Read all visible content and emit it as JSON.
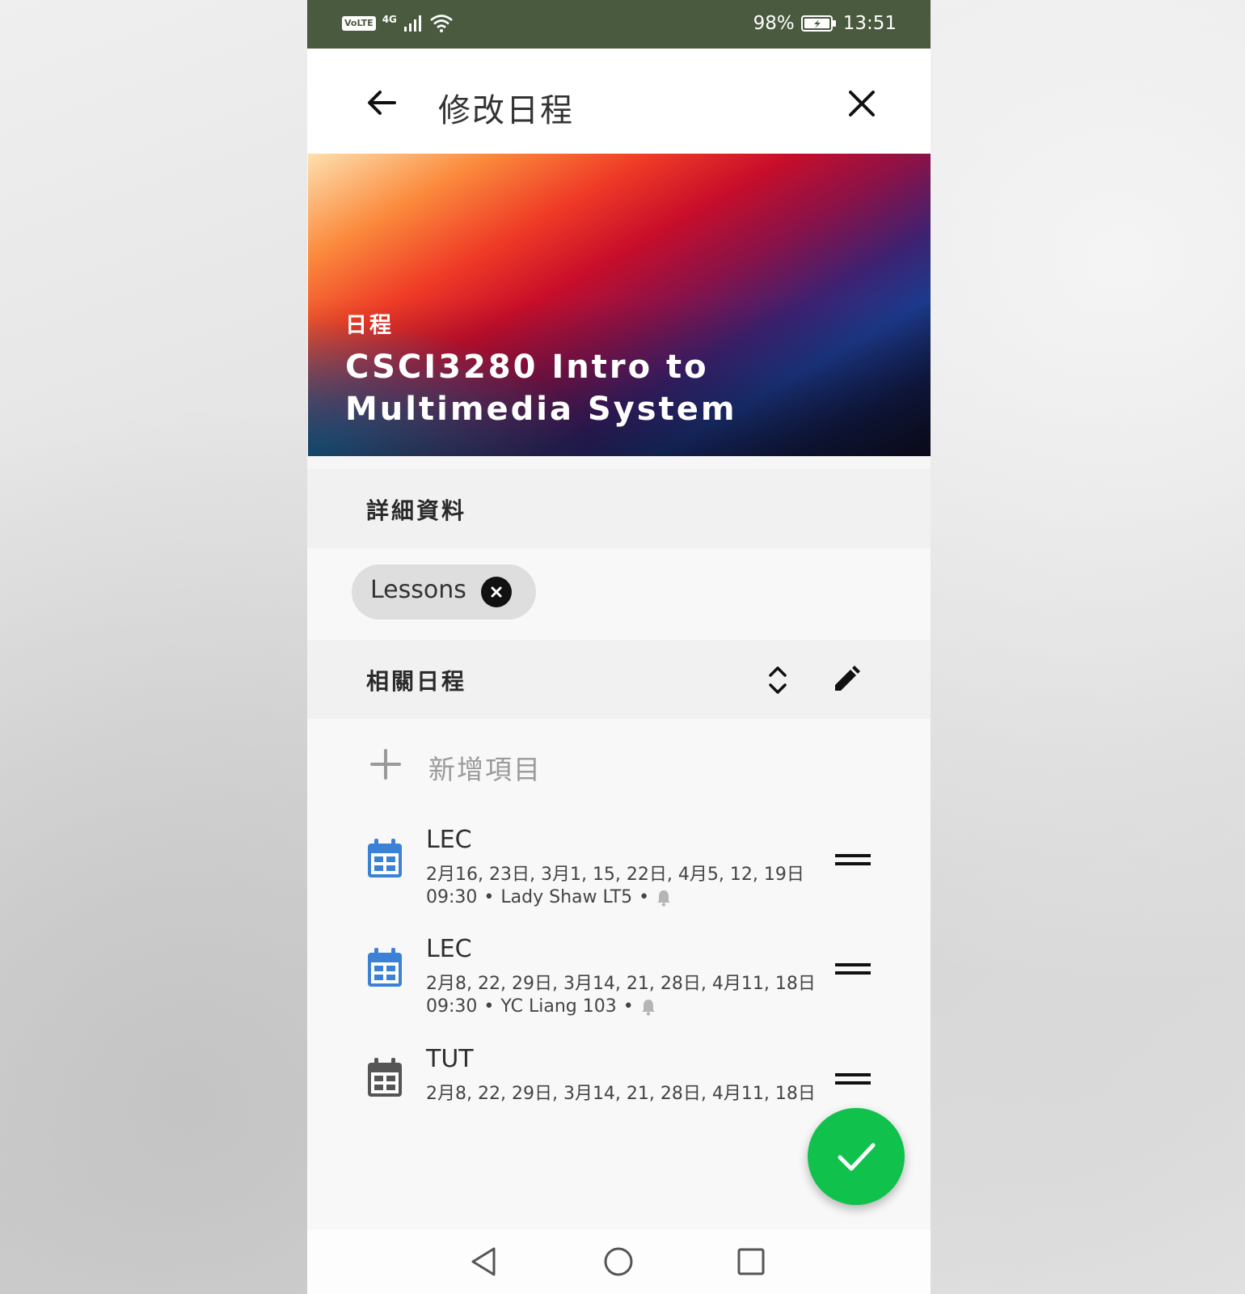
{
  "status_bar": {
    "volte": "VoLTE",
    "network": "4G",
    "battery": "98%",
    "time": "13:51"
  },
  "app_bar": {
    "title": "修改日程",
    "back_icon": "arrow-left-icon",
    "close_icon": "close-icon"
  },
  "banner": {
    "label": "日程",
    "title": "CSCI3280 Intro to Multimedia System"
  },
  "details": {
    "header": "詳細資料",
    "tags": [
      {
        "label": "Lessons"
      }
    ]
  },
  "related": {
    "header": "相關日程",
    "add_label": "新增項目",
    "items": [
      {
        "title": "LEC",
        "dates": "2月16, 23日, 3月1, 15, 22日, 4月5, 12, 19日",
        "time": "09:30",
        "location": "Lady Shaw LT5",
        "icon_color": "#3b82d6",
        "has_reminder": true
      },
      {
        "title": "LEC",
        "dates": "2月8, 22, 29日, 3月14, 21, 28日, 4月11, 18日",
        "time": "09:30",
        "location": "YC Liang 103",
        "icon_color": "#3b82d6",
        "has_reminder": true
      },
      {
        "title": "TUT",
        "dates": "2月8, 22, 29日, 3月14, 21, 28日, 4月11, 18日",
        "icon_color": "#555555"
      }
    ]
  },
  "fab": {
    "icon": "check-icon",
    "color": "#10c24c"
  },
  "nav_bar": {
    "icons": [
      "back-triangle-icon",
      "home-circle-icon",
      "recents-square-icon"
    ]
  },
  "colors": {
    "status_bar": "#4a5a3e",
    "accent_blue": "#3b82d6",
    "fab_green": "#10c24c"
  }
}
